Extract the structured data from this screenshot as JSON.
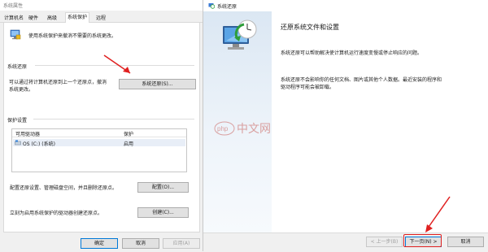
{
  "left": {
    "title": "系统属性",
    "tabs": [
      "计算机名",
      "硬件",
      "高级",
      "系统保护",
      "远程"
    ],
    "active_tab_index": 3,
    "intro": "使用系统保护来撤消不需要的系统更改。",
    "restore_group": {
      "label": "系统还原",
      "desc_line1": "可以通过将计算机还原到上一个还原点，撤消",
      "desc_line2": "系统更改。",
      "button": "系统还原(S)..."
    },
    "protection_group": {
      "label": "保护设置",
      "col_drive": "可用驱动器",
      "col_protect": "保护",
      "rows": [
        {
          "drive": "OS (C:) (系统)",
          "protect": "启用"
        }
      ]
    },
    "configure": {
      "text": "配置还原设置、管理磁盘空间，并且删除还原点。",
      "button": "配置(O)..."
    },
    "create": {
      "text": "立刻为启用系统保护的驱动器创建还原点。",
      "button": "创建(C)..."
    },
    "footer": {
      "ok": "确定",
      "cancel": "取消",
      "apply": "应用(A)"
    }
  },
  "right": {
    "title": "系统还原",
    "heading": "还原系统文件和设置",
    "para1_line1": "系统还原可以帮助解决使计算机运行速度变慢或停止响应的问题。",
    "para2_line1": "系统还原不会影响你的任何文档、图片或其他个人数据。最近安装的程序和",
    "para2_line2": "驱动程序可能会被卸载。",
    "footer": {
      "back": "< 上一步(B)",
      "next": "下一页(N) >",
      "cancel": "取消"
    }
  },
  "watermark": {
    "text": "php 中文网"
  },
  "colors": {
    "arrow": "#e02020",
    "accent": "#0078d7",
    "watermark": "#d9a0a0"
  }
}
